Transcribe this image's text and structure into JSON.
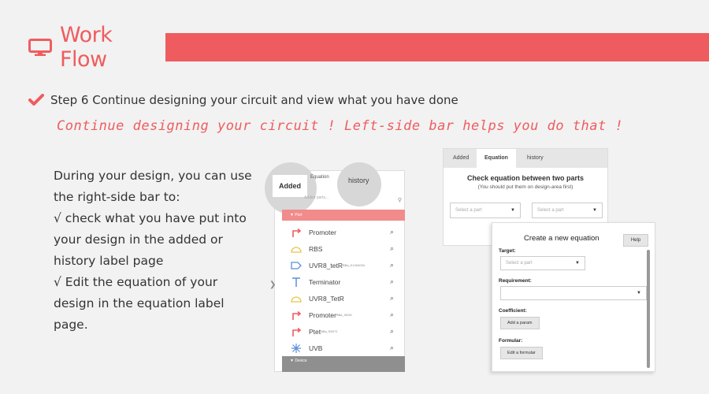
{
  "header": {
    "title": "Work Flow",
    "icon": "monitor-icon",
    "accent": "#ef5c5f"
  },
  "step": {
    "icon": "checkmark-icon",
    "text": "Step 6 Continue designing your circuit and view what you have done"
  },
  "subtitle": "Continue designing your circuit ! Left-side bar helps you do that !",
  "description": [
    "During your design, you can use",
    "the right-side bar to:",
    "√ check what you have put into",
    "your design in the added or",
    "history label page",
    "√ Edit the equation of your",
    "design in the equation label",
    "page."
  ],
  "sidebar_shot": {
    "tabs": {
      "added": "Added",
      "equation": "Equation",
      "history": "history"
    },
    "search_placeholder": "Added parts...",
    "part_header": "Part",
    "device_header": "Device",
    "items": [
      {
        "label": "Promoter",
        "sub": "",
        "icon": "promoter-arrow-icon"
      },
      {
        "label": "RBS",
        "sub": "",
        "icon": "rbs-icon"
      },
      {
        "label": "UVR8_tetR",
        "sub": "BBa_K1404004",
        "icon": "cds-icon"
      },
      {
        "label": "Terminator",
        "sub": "",
        "icon": "terminator-icon"
      },
      {
        "label": "UVR8_TetR",
        "sub": "",
        "icon": "rbs-icon"
      },
      {
        "label": "Promoter",
        "sub": "BBa_I0040",
        "icon": "promoter-arrow-icon"
      },
      {
        "label": "Ptet",
        "sub": "BBa_R0071",
        "icon": "promoter-arrow-icon"
      },
      {
        "label": "UVB",
        "sub": "",
        "icon": "uvb-icon"
      }
    ]
  },
  "equation_shot": {
    "tabs": {
      "added": "Added",
      "equation": "Equation",
      "history": "history"
    },
    "title": "Check equation between two parts",
    "subtitle": "(You should put them on design-area first)",
    "select1": "Select a part",
    "select2": "Select a part"
  },
  "create_shot": {
    "title": "Create a new equation",
    "help": "Help",
    "target_label": "Target:",
    "target_placeholder": "Select a part",
    "requirement_label": "Requirement:",
    "coefficient_label": "Coefficient:",
    "add_param": "Add a param",
    "formular_label": "Formular:",
    "edit_formular": "Edit a formular"
  }
}
